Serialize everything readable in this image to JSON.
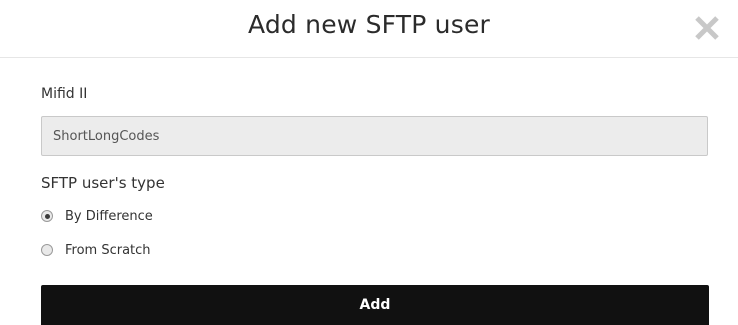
{
  "dialog": {
    "title": "Add new SFTP user",
    "close_icon": "close-icon"
  },
  "form": {
    "field_label": "Mifid II",
    "field_value": "ShortLongCodes",
    "type_label": "SFTP user's type",
    "options": [
      {
        "label": "By Difference",
        "checked": true
      },
      {
        "label": "From Scratch",
        "checked": false
      }
    ],
    "submit_label": "Add"
  },
  "colors": {
    "button_bg": "#111111",
    "input_bg": "#ececec",
    "close_icon": "#c8c8c8"
  }
}
